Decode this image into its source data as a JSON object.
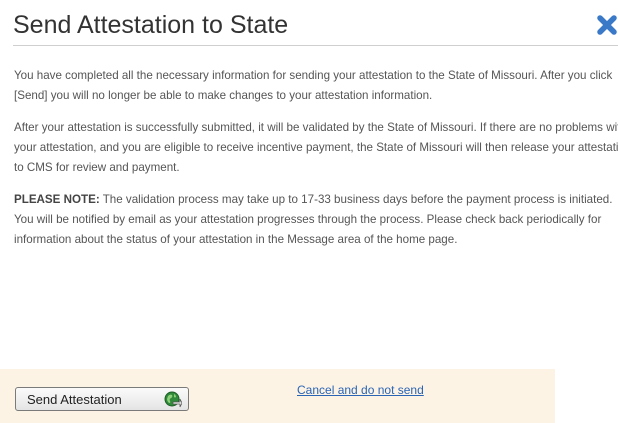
{
  "dialog": {
    "title": "Send Attestation to State",
    "close_icon": "close-x-icon",
    "paragraphs": [
      "You have completed all the necessary information for sending your attestation to the State of Missouri. After you click [Send] you will no longer be able to make changes to your attestation information.",
      "After your attestation is successfully submitted, it will be validated by the State of Missouri. If there are no problems with your attestation, and you are eligible to receive incentive payment, the State of Missouri will then release your attestation to CMS for review and payment."
    ],
    "note": {
      "label": "PLEASE NOTE:",
      "text": " The validation process may take up to 17-33 business days before the payment process is initiated. You will be notified by email as your attestation progresses through the process. Please check back periodically for information about the status of your attestation in the Message area of the home page."
    }
  },
  "actions": {
    "send_label": "Send Attestation",
    "send_icon": "globe-arrow-icon",
    "cancel_label": "Cancel and do not send"
  },
  "colors": {
    "close_icon": "#3a78c8",
    "link": "#2a64b4",
    "action_bar": "#fcf3e5",
    "globe": "#2f8a3a"
  }
}
